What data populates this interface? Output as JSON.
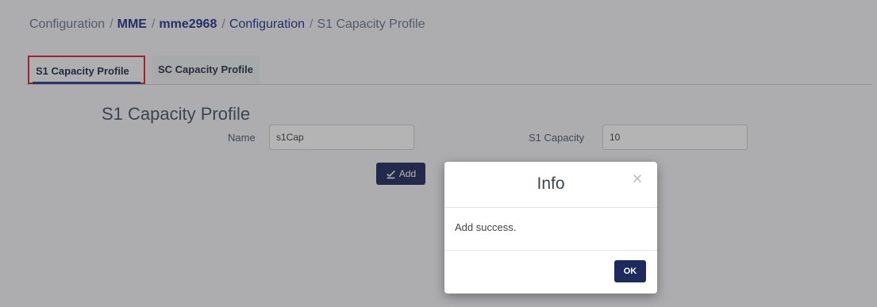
{
  "breadcrumb": {
    "items": [
      "Configuration",
      "MME",
      "mme2968",
      "Configuration",
      "S1 Capacity Profile"
    ],
    "separator": "/"
  },
  "tabs": {
    "active_label": "S1 Capacity Profile",
    "inactive_label": "SC Capacity Profile"
  },
  "form": {
    "title": "S1 Capacity Profile",
    "name_label": "Name",
    "name_value": "s1Cap",
    "capacity_label": "S1 Capacity",
    "capacity_value": "10",
    "add_label": "Add"
  },
  "dialog": {
    "title": "Info",
    "message": "Add success.",
    "ok_label": "OK"
  },
  "colors": {
    "primary_button": "#1f2a5c",
    "active_tab_highlight": "#e0232a",
    "breadcrumb_link": "#23338a"
  },
  "icons": {
    "add": "check-edit-icon",
    "close": "close-icon"
  }
}
